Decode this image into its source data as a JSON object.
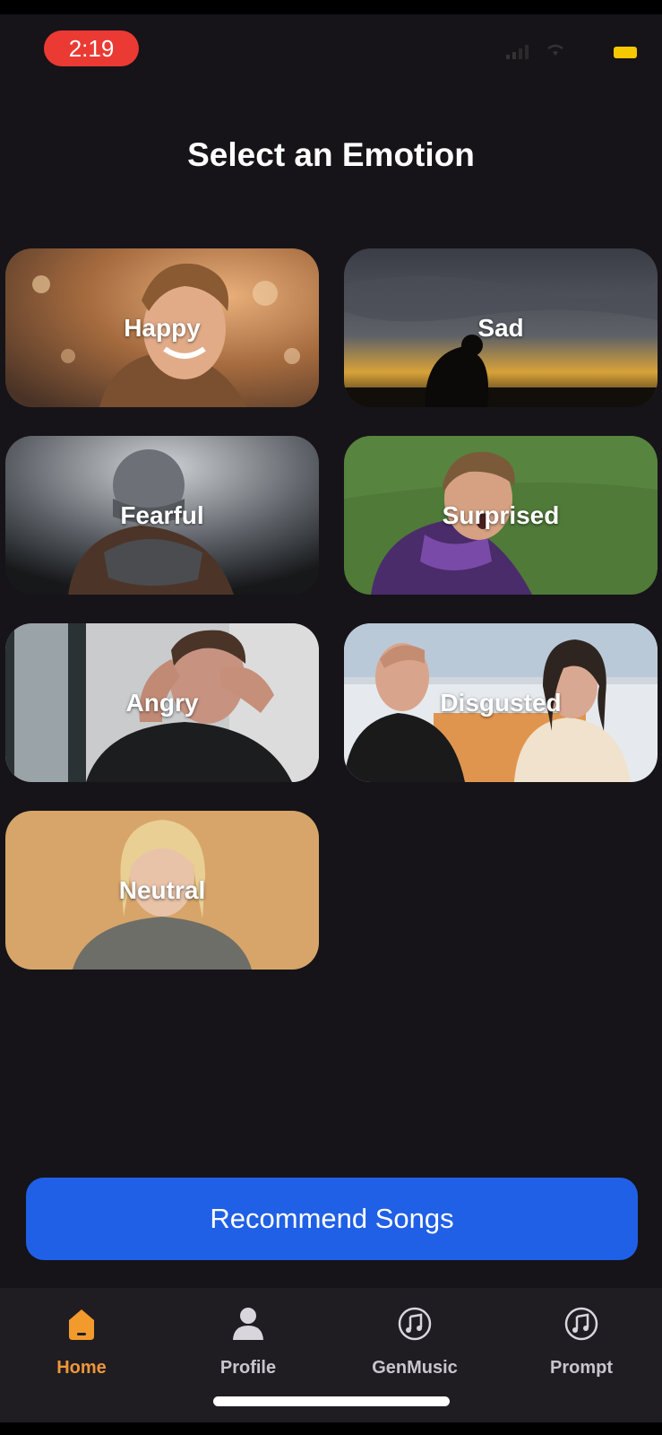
{
  "status_bar": {
    "time": "2:19"
  },
  "page": {
    "title": "Select an Emotion"
  },
  "emotions": [
    {
      "label": "Happy"
    },
    {
      "label": "Sad"
    },
    {
      "label": "Fearful"
    },
    {
      "label": "Surprised"
    },
    {
      "label": "Angry"
    },
    {
      "label": "Disgusted"
    },
    {
      "label": "Neutral"
    }
  ],
  "cta": {
    "label": "Recommend Songs"
  },
  "tabs": [
    {
      "label": "Home",
      "icon": "home-icon",
      "active": true
    },
    {
      "label": "Profile",
      "icon": "person-icon",
      "active": false
    },
    {
      "label": "GenMusic",
      "icon": "music-note-icon",
      "active": false
    },
    {
      "label": "Prompt",
      "icon": "music-note-icon",
      "active": false
    }
  ],
  "colors": {
    "background": "#161418",
    "accent": "#2060e6",
    "active_tab": "#f0963a",
    "time_pill": "#ea3a33"
  }
}
